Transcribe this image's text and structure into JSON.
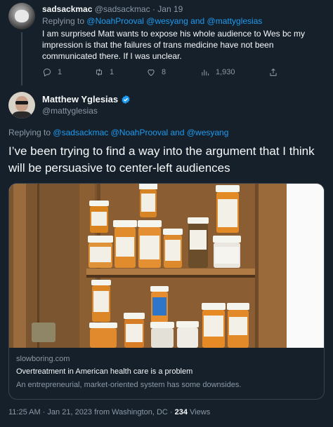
{
  "reply_tweet": {
    "name": "sadsackmac",
    "handle": "@sadsackmac",
    "separator": "·",
    "date": "Jan 19",
    "replying_prefix": "Replying to",
    "replying_handles": "@NoahProoval @wesyang and @mattyglesias",
    "body": "I am surprised Matt wants to expose his whole audience to Wes bc my impression is that the failures of trans medicine have not been communicated there. If I was unclear.",
    "reply_count": "1",
    "retweet_count": "1",
    "like_count": "8",
    "view_count": "1,930"
  },
  "main_tweet": {
    "name": "Matthew Yglesias",
    "handle": "@mattyglesias",
    "replying_prefix": "Replying to",
    "replying_handles": "@sadsackmac @NoahProoval and @wesyang",
    "text": "I’ve been trying to find a way into the argument that I think will be persuasive to center-left audiences",
    "card": {
      "domain": "slowboring.com",
      "title": "Overtreatment in American health care is a problem",
      "description": "An entrepreneurial, market-oriented system has some downsides."
    },
    "meta": {
      "time_date_place": "11:25 AM · Jan 21, 2023 from Washington, DC ·",
      "views_count": "234",
      "views_label": "Views"
    }
  },
  "icons": {
    "reply": "reply-icon",
    "retweet": "retweet-icon",
    "like": "like-icon",
    "views": "views-icon",
    "share": "share-icon",
    "verified": "verified-badge-icon"
  },
  "colors": {
    "background": "#15202b",
    "link": "#1d9bf0",
    "muted": "#8b98a5",
    "text": "#f7f9f9",
    "border": "#38444d"
  }
}
